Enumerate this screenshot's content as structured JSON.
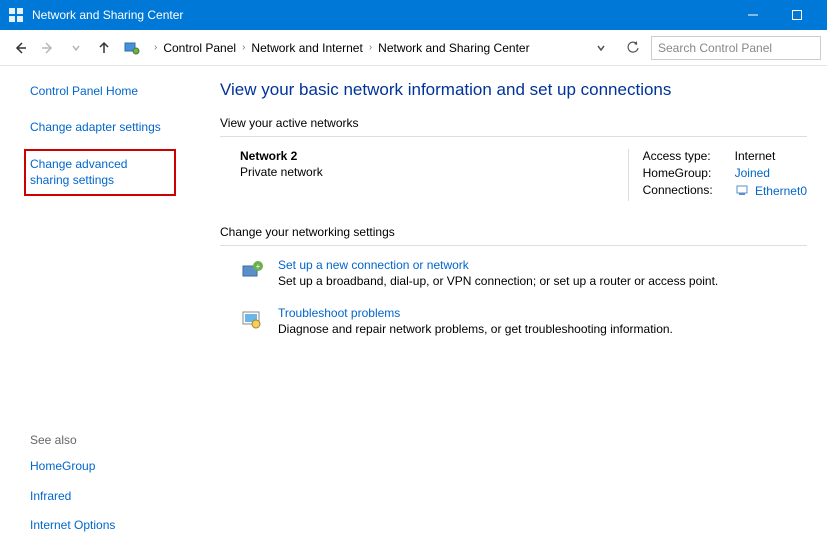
{
  "titlebar": {
    "title": "Network and Sharing Center"
  },
  "breadcrumbs": {
    "items": [
      "Control Panel",
      "Network and Internet",
      "Network and Sharing Center"
    ]
  },
  "search": {
    "placeholder": "Search Control Panel"
  },
  "sidebar": {
    "home": "Control Panel Home",
    "links": [
      "Change adapter settings",
      "Change advanced sharing settings"
    ],
    "seealso_label": "See also",
    "seealso": [
      "HomeGroup",
      "Infrared",
      "Internet Options"
    ]
  },
  "main": {
    "heading": "View your basic network information and set up connections",
    "view_networks_label": "View your active networks",
    "network": {
      "name": "Network  2",
      "type": "Private network",
      "access_label": "Access type:",
      "access_value": "Internet",
      "homegroup_label": "HomeGroup:",
      "homegroup_value": "Joined",
      "connections_label": "Connections:",
      "connections_value": "Ethernet0"
    },
    "change_settings_label": "Change your networking settings",
    "setup": {
      "link": "Set up a new connection or network",
      "desc": "Set up a broadband, dial-up, or VPN connection; or set up a router or access point."
    },
    "troubleshoot": {
      "link": "Troubleshoot problems",
      "desc": "Diagnose and repair network problems, or get troubleshooting information."
    }
  }
}
